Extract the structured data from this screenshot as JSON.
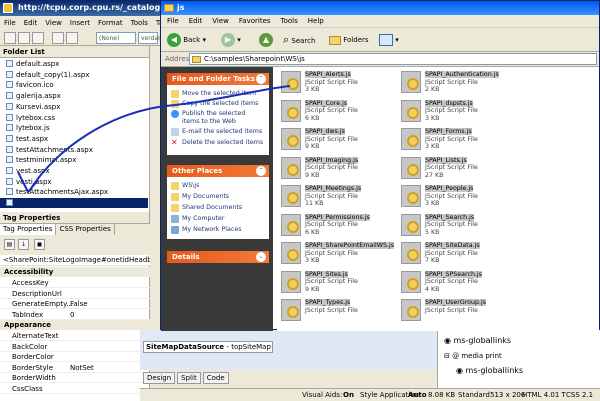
{
  "spd": {
    "title": "http://tcpu.corp.cpu.rs/_catalogs/masterpage/m",
    "menu": [
      "File",
      "Edit",
      "View",
      "Insert",
      "Format",
      "Tools",
      "Tabl"
    ],
    "style_select": "(None)",
    "font_select": "verdan",
    "folder_list": {
      "title": "Folder List",
      "items": [
        "default.aspx",
        "default_copy(1).aspx",
        "favicon.ico",
        "galerija.aspx",
        "Kursevi.aspx",
        "lytebox.css",
        "lytebox.js",
        "test.aspx",
        "testAttachments.aspx",
        "testminimal.aspx",
        "vest.aspx",
        "vesti.aspx",
        "testAttachmentsAjax.aspx",
        ""
      ],
      "selected_index": 13
    },
    "tag_properties": {
      "title": "Tag Properties",
      "tabs": [
        "Tag Properties",
        "CSS Properties"
      ],
      "tag_path": "<SharePoint:SiteLogoImage#onetidHeadbnnr...",
      "categories": [
        {
          "name": "Accessibility",
          "rows": [
            [
              "AccessKey",
              ""
            ],
            [
              "DescriptionUrl",
              ""
            ],
            [
              "GenerateEmpty...",
              "False"
            ],
            [
              "TabIndex",
              "0"
            ]
          ]
        },
        {
          "name": "Appearance",
          "rows": [
            [
              "AlternateText",
              ""
            ],
            [
              "BackColor",
              ""
            ],
            [
              "BorderColor",
              ""
            ],
            [
              "BorderStyle",
              "NotSet"
            ],
            [
              "BorderWidth",
              ""
            ],
            [
              "CssClass",
              ""
            ]
          ]
        }
      ]
    },
    "editor_tab": {
      "main": "SiteMapDataSource",
      "sub": "- topSiteMap"
    },
    "design_tabs": [
      "Design",
      "Split",
      "Code"
    ],
    "css_panel": [
      "ms-globallinks",
      "@ media print",
      "ms-globallinks"
    ],
    "status": {
      "visual_aids_label": "Visual Aids:",
      "visual_aids": "On",
      "style_app_label": "Style Application:",
      "style_app": "Auto",
      "size": "8.08 KB",
      "mode": "Standard",
      "dims": "513 x 206",
      "doctype": "HTML 4.01 T",
      "css": "CSS 2.1"
    }
  },
  "explorer": {
    "title": "js",
    "menu": [
      "File",
      "Edit",
      "View",
      "Favorites",
      "Tools",
      "Help"
    ],
    "toolbar": {
      "back": "Back",
      "search": "Search",
      "folders": "Folders"
    },
    "address": {
      "label": "Address",
      "path": "C:\\samples\\Sharepoint\\WS\\js"
    },
    "tasks": {
      "title": "File and Folder Tasks",
      "items": [
        "Move the selected item",
        "Copy the selected items",
        "Publish the selected items to the Web",
        "E-mail the selected items",
        "Delete the selected items"
      ]
    },
    "places": {
      "title": "Other Places",
      "items": [
        "WS\\js",
        "My Documents",
        "Shared Documents",
        "My Computer",
        "My Network Places"
      ]
    },
    "details": {
      "title": "Details"
    },
    "files": [
      {
        "name": "SPAPI_Alerts.js",
        "type": "JScript Script File",
        "size": "3 KB"
      },
      {
        "name": "SPAPI_Authentication.js",
        "type": "JScript Script File",
        "size": "2 KB"
      },
      {
        "name": "SPAPI_Core.js",
        "type": "JScript Script File",
        "size": "6 KB"
      },
      {
        "name": "SPAPI_dspsts.js",
        "type": "JScript Script File",
        "size": "3 KB"
      },
      {
        "name": "SPAPI_dws.js",
        "type": "JScript Script File",
        "size": "9 KB"
      },
      {
        "name": "SPAPI_Forms.js",
        "type": "JScript Script File",
        "size": "3 KB"
      },
      {
        "name": "SPAPI_Imaging.js",
        "type": "JScript Script File",
        "size": "9 KB"
      },
      {
        "name": "SPAPI_Lists.js",
        "type": "JScript Script File",
        "size": "27 KB"
      },
      {
        "name": "SPAPI_Meetings.js",
        "type": "JScript Script File",
        "size": "11 KB"
      },
      {
        "name": "SPAPI_People.js",
        "type": "JScript Script File",
        "size": "3 KB"
      },
      {
        "name": "SPAPI_Permissions.js",
        "type": "JScript Script File",
        "size": "6 KB"
      },
      {
        "name": "SPAPI_Search.js",
        "type": "JScript Script File",
        "size": "5 KB"
      },
      {
        "name": "SPAPI_SharePointEmailWS.js",
        "type": "JScript Script File",
        "size": "3 KB"
      },
      {
        "name": "SPAPI_SiteData.js",
        "type": "JScript Script File",
        "size": "7 KB"
      },
      {
        "name": "SPAPI_Sites.js",
        "type": "JScript Script File",
        "size": "9 KB"
      },
      {
        "name": "SPAPI_SPSearch.js",
        "type": "JScript Script File",
        "size": "4 KB"
      },
      {
        "name": "SPAPI_Types.js",
        "type": "JScript Script File",
        "size": ""
      },
      {
        "name": "SPAPI_UserGroup.js",
        "type": "JScript Script File",
        "size": ""
      }
    ]
  }
}
